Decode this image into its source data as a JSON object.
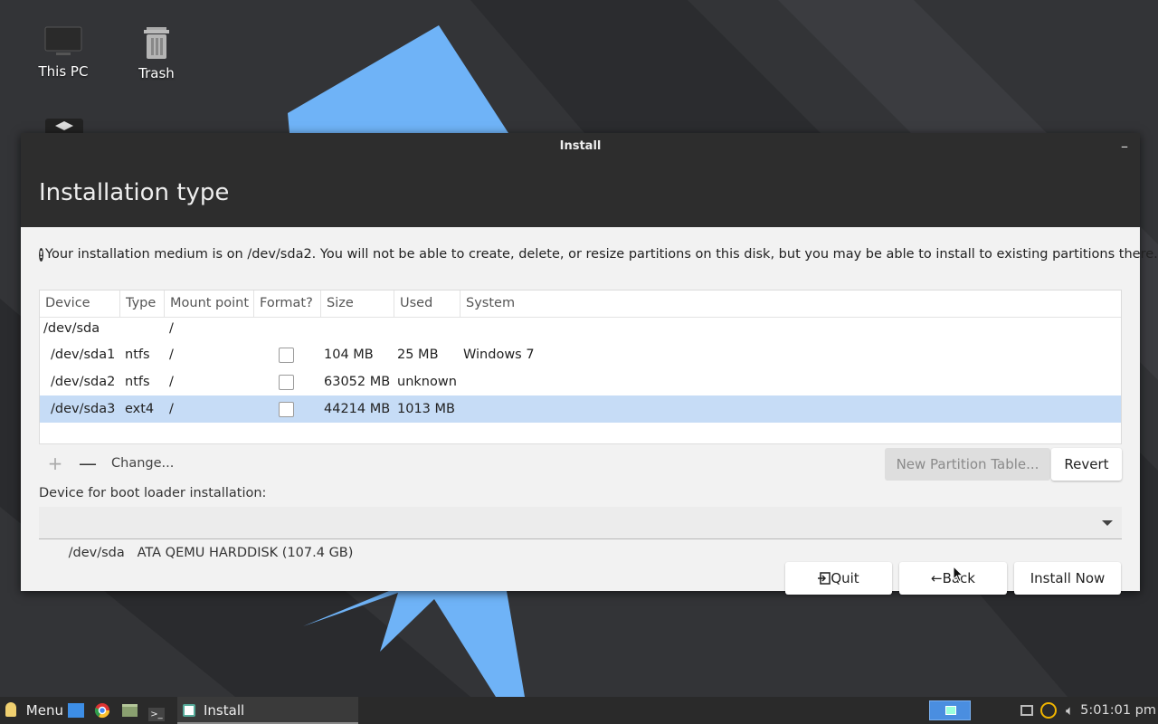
{
  "desktop": {
    "icons": [
      {
        "label": "This PC",
        "icon": "computer-icon"
      },
      {
        "label": "Trash",
        "icon": "trash-icon"
      }
    ]
  },
  "window": {
    "title": "Install",
    "minimize_label": "–",
    "heading": "Installation type",
    "notice": "Your installation medium is on /dev/sda2. You will not be able to create, delete, or resize partitions on this disk, but you may be able to install to existing partitions there.",
    "table": {
      "columns": [
        "Device",
        "Type",
        "Mount point",
        "Format?",
        "Size",
        "Used",
        "System"
      ],
      "rows": [
        {
          "device": "/dev/sda",
          "type": "",
          "mount": "/",
          "format": null,
          "size": "",
          "used": "",
          "system": ""
        },
        {
          "device": "/dev/sda1",
          "type": "ntfs",
          "mount": "/",
          "format": false,
          "size": "104 MB",
          "used": "25 MB",
          "system": "Windows 7"
        },
        {
          "device": "/dev/sda2",
          "type": "ntfs",
          "mount": "/",
          "format": false,
          "size": "63052 MB",
          "used": "unknown",
          "system": ""
        },
        {
          "device": "/dev/sda3",
          "type": "ext4",
          "mount": "/",
          "format": false,
          "size": "44214 MB",
          "used": "1013 MB",
          "system": "",
          "selected": true
        }
      ]
    },
    "toolbar": {
      "add": "+",
      "remove": "—",
      "change": "Change...",
      "new_partition_table": "New Partition Table...",
      "revert": "Revert"
    },
    "bootloader": {
      "label": "Device for boot loader installation:",
      "value": "/dev/sda   ATA QEMU HARDDISK (107.4 GB)"
    },
    "buttons": {
      "quit": "Quit",
      "back": "Back",
      "install_now": "Install Now"
    }
  },
  "taskbar": {
    "menu_label": "Menu",
    "task_label": "Install",
    "clock": "5:01:01 pm"
  },
  "colors": {
    "accent": "#4a8ee0",
    "selection": "#c6dcf6",
    "titlebar": "#2d2d2d"
  }
}
